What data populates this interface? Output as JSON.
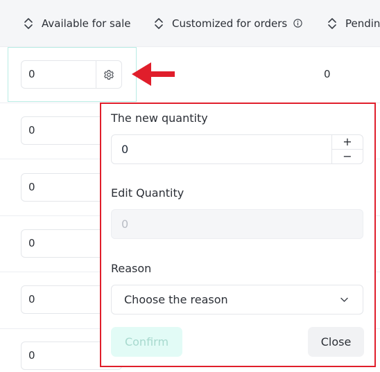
{
  "table": {
    "columns": [
      {
        "label": "Available for sale"
      },
      {
        "label": "Customized for orders"
      },
      {
        "label": "Pendin"
      }
    ],
    "rows": [
      {
        "available": "0",
        "other": "0"
      },
      {
        "available": "0"
      },
      {
        "available": "0"
      },
      {
        "available": "0"
      },
      {
        "available": "0"
      },
      {
        "available": "0"
      }
    ]
  },
  "popover": {
    "new_quantity_label": "The new quantity",
    "new_quantity_value": "0",
    "stepper_plus": "+",
    "stepper_minus": "−",
    "edit_quantity_label": "Edit Quantity",
    "edit_quantity_value": "0",
    "reason_label": "Reason",
    "reason_placeholder": "Choose the reason",
    "confirm_label": "Confirm",
    "close_label": "Close"
  },
  "colors": {
    "annotation_red": "#e01e2b",
    "highlight_teal": "#b9ece4",
    "confirm_bg": "#e2fbf6"
  }
}
